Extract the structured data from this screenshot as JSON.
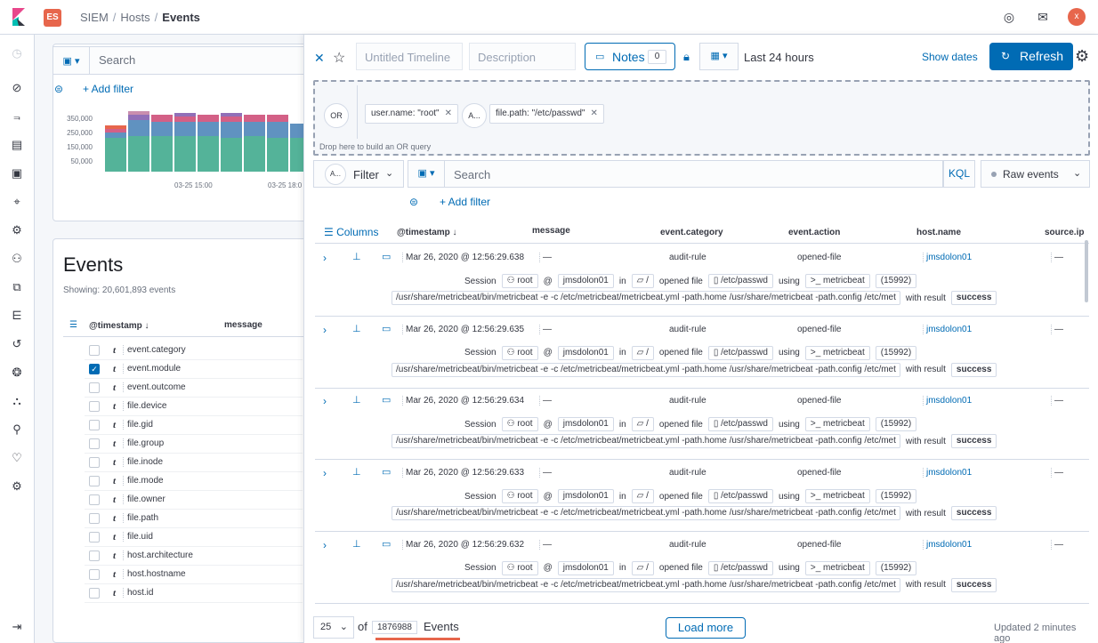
{
  "app": {
    "badge": "ES",
    "avatar": "x"
  },
  "breadcrumbs": [
    "SIEM",
    "Hosts",
    "Events"
  ],
  "background": {
    "search_placeholder": "Search",
    "add_filter": "+ Add filter",
    "y_ticks": [
      "350,000",
      "250,000",
      "150,000",
      "50,000"
    ],
    "x_ticks": [
      "03-25 15:00",
      "03-25 18:0"
    ],
    "events_title": "Events",
    "showing": "Showing: 20,601,893 events",
    "columns": {
      "timestamp": "@timestamp",
      "message": "message"
    },
    "fields": [
      {
        "name": "event.category",
        "type": "t",
        "checked": false
      },
      {
        "name": "event.module",
        "type": "t",
        "checked": true
      },
      {
        "name": "event.outcome",
        "type": "t",
        "checked": false
      },
      {
        "name": "file.device",
        "type": "t",
        "checked": false
      },
      {
        "name": "file.gid",
        "type": "t",
        "checked": false
      },
      {
        "name": "file.group",
        "type": "t",
        "checked": false
      },
      {
        "name": "file.inode",
        "type": "t",
        "checked": false
      },
      {
        "name": "file.mode",
        "type": "t",
        "checked": false
      },
      {
        "name": "file.owner",
        "type": "t",
        "checked": false
      },
      {
        "name": "file.path",
        "type": "t",
        "checked": false
      },
      {
        "name": "file.uid",
        "type": "t",
        "checked": false
      },
      {
        "name": "host.architecture",
        "type": "t",
        "checked": false
      },
      {
        "name": "host.hostname",
        "type": "t",
        "checked": false
      },
      {
        "name": "host.id",
        "type": "t",
        "checked": false
      }
    ]
  },
  "timeline": {
    "title_placeholder": "Untitled Timeline",
    "description_placeholder": "Description",
    "notes_label": "Notes",
    "notes_count": "0",
    "date_range": "Last 24 hours",
    "show_dates": "Show dates",
    "refresh": "Refresh",
    "or_badge": "OR",
    "and_badge": "A...",
    "pills": [
      "user.name: \"root\"",
      "file.path: \"/etc/passwd\""
    ],
    "drop_hint": "Drop here to build an OR query",
    "filter_badge": "A...",
    "filter_label": "Filter",
    "search_placeholder": "Search",
    "kql": "KQL",
    "view_mode": "Raw events",
    "add_filter": "+ Add filter",
    "columns_btn": "Columns",
    "column_headers": [
      "@timestamp",
      "message",
      "event.category",
      "event.action",
      "host.name",
      "source.ip"
    ],
    "rows": [
      {
        "timestamp": "Mar 26, 2020 @ 12:56:29.638",
        "message": "—",
        "category": "audit-rule",
        "action": "opened-file",
        "host": "jmsdolon01",
        "source": "—"
      },
      {
        "timestamp": "Mar 26, 2020 @ 12:56:29.635",
        "message": "—",
        "category": "audit-rule",
        "action": "opened-file",
        "host": "jmsdolon01",
        "source": "—"
      },
      {
        "timestamp": "Mar 26, 2020 @ 12:56:29.634",
        "message": "—",
        "category": "audit-rule",
        "action": "opened-file",
        "host": "jmsdolon01",
        "source": "—"
      },
      {
        "timestamp": "Mar 26, 2020 @ 12:56:29.633",
        "message": "—",
        "category": "audit-rule",
        "action": "opened-file",
        "host": "jmsdolon01",
        "source": "—"
      },
      {
        "timestamp": "Mar 26, 2020 @ 12:56:29.632",
        "message": "—",
        "category": "audit-rule",
        "action": "opened-file",
        "host": "jmsdolon01",
        "source": "—"
      }
    ],
    "detail": {
      "session": "Session",
      "user": "root",
      "at": "@",
      "host": "jmsdolon01",
      "in": "in",
      "dir": "/",
      "opened_file": "opened file",
      "path": "/etc/passwd",
      "using": "using",
      "process": "metricbeat",
      "pid": "(15992)",
      "args": "/usr/share/metricbeat/bin/metricbeat -e -c /etc/metricbeat/metricbeat.yml -path.home /usr/share/metricbeat -path.config /etc/met",
      "with_result": "with result",
      "result": "success"
    },
    "footer": {
      "per_page": "25",
      "of": "of",
      "total": "1876988",
      "events": "Events",
      "load_more": "Load more",
      "updated": "Updated 2 minutes ago"
    }
  },
  "colors": {
    "accent": "#006bb4",
    "badge": "#e7664c"
  }
}
